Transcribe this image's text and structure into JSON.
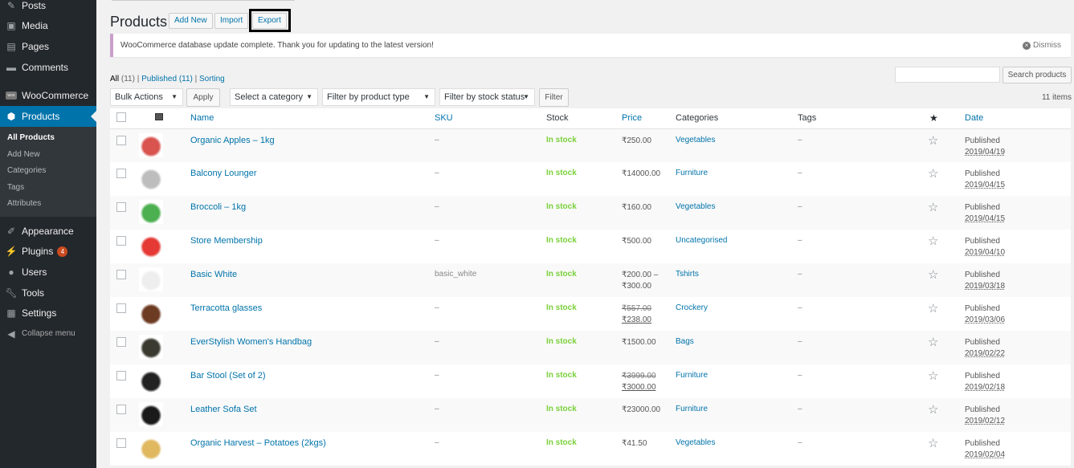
{
  "sidebar": {
    "items": [
      {
        "label": "Posts",
        "icon": "pin-icon"
      },
      {
        "label": "Media",
        "icon": "media-icon"
      },
      {
        "label": "Pages",
        "icon": "pages-icon"
      },
      {
        "label": "Comments",
        "icon": "comments-icon"
      }
    ],
    "woocommerce": {
      "label": "WooCommerce",
      "icon": "woo-icon"
    },
    "products": {
      "label": "Products",
      "icon": "box-icon"
    },
    "submenu": [
      "All Products",
      "Add New",
      "Categories",
      "Tags",
      "Attributes"
    ],
    "items2": [
      {
        "label": "Appearance",
        "icon": "brush-icon"
      },
      {
        "label": "Plugins",
        "icon": "plug-icon",
        "badge": "4"
      },
      {
        "label": "Users",
        "icon": "user-icon"
      },
      {
        "label": "Tools",
        "icon": "wrench-icon"
      },
      {
        "label": "Settings",
        "icon": "settings-icon"
      }
    ],
    "collapse_label": "Collapse menu"
  },
  "header": {
    "title": "Products",
    "add_new": "Add New",
    "import": "Import",
    "export": "Export"
  },
  "notice": {
    "text": "WooCommerce database update complete. Thank you for updating to the latest version!",
    "dismiss": "Dismiss"
  },
  "views": {
    "all": "All",
    "all_count": "(11)",
    "published": "Published",
    "published_count": "(11)",
    "sorting": "Sorting"
  },
  "search": {
    "placeholder": "",
    "button": "Search products"
  },
  "filters": {
    "bulk_actions": "Bulk Actions",
    "apply": "Apply",
    "category": "Select a category",
    "product_type": "Filter by product type",
    "stock_status": "Filter by stock status",
    "filter": "Filter",
    "items_count": "11 items"
  },
  "table": {
    "headers": {
      "name": "Name",
      "sku": "SKU",
      "stock": "Stock",
      "price": "Price",
      "categories": "Categories",
      "tags": "Tags",
      "date": "Date"
    },
    "rows": [
      {
        "name": "Organic Apples – 1kg",
        "sku": "–",
        "stock": "In stock",
        "price": "₹250.00",
        "price_old": "",
        "price_new": "",
        "category": "Vegetables",
        "tags": "–",
        "status": "Published",
        "date": "2019/04/19",
        "thumb": "#d9534f"
      },
      {
        "name": "Balcony Lounger",
        "sku": "–",
        "stock": "In stock",
        "price": "₹14000.00",
        "price_old": "",
        "price_new": "",
        "category": "Furniture",
        "tags": "–",
        "status": "Published",
        "date": "2019/04/15",
        "thumb": "#bdbdbd"
      },
      {
        "name": "Broccoli – 1kg",
        "sku": "–",
        "stock": "In stock",
        "price": "₹160.00",
        "price_old": "",
        "price_new": "",
        "category": "Vegetables",
        "tags": "–",
        "status": "Published",
        "date": "2019/04/15",
        "thumb": "#4caf50"
      },
      {
        "name": "Store Membership",
        "sku": "–",
        "stock": "In stock",
        "price": "₹500.00",
        "price_old": "",
        "price_new": "",
        "category": "Uncategorised",
        "tags": "–",
        "status": "Published",
        "date": "2019/04/10",
        "thumb": "#e53935"
      },
      {
        "name": "Basic White",
        "sku": "basic_white",
        "stock": "In stock",
        "price": "₹200.00 –",
        "price2": "₹300.00",
        "price_old": "",
        "price_new": "",
        "category": "Tshirts",
        "tags": "–",
        "status": "Published",
        "date": "2019/03/18",
        "thumb": "#eeeeee"
      },
      {
        "name": "Terracotta glasses",
        "sku": "–",
        "stock": "In stock",
        "price": "",
        "price_old": "₹557.00",
        "price_new": "₹238.00",
        "category": "Crockery",
        "tags": "–",
        "status": "Published",
        "date": "2019/03/06",
        "thumb": "#6d3a22"
      },
      {
        "name": "EverStylish Women's Handbag",
        "sku": "–",
        "stock": "In stock",
        "price": "₹1500.00",
        "price_old": "",
        "price_new": "",
        "category": "Bags",
        "tags": "–",
        "status": "Published",
        "date": "2019/02/22",
        "thumb": "#3a3a30"
      },
      {
        "name": "Bar Stool (Set of 2)",
        "sku": "–",
        "stock": "In stock",
        "price": "",
        "price_old": "₹3999.00",
        "price_new": "₹3000.00",
        "category": "Furniture",
        "tags": "–",
        "status": "Published",
        "date": "2019/02/18",
        "thumb": "#222222"
      },
      {
        "name": "Leather Sofa Set",
        "sku": "–",
        "stock": "In stock",
        "price": "₹23000.00",
        "price_old": "",
        "price_new": "",
        "category": "Furniture",
        "tags": "–",
        "status": "Published",
        "date": "2019/02/12",
        "thumb": "#1a1a1a"
      },
      {
        "name": "Organic Harvest – Potatoes (2kgs)",
        "sku": "–",
        "stock": "In stock",
        "price": "₹41.50",
        "price_old": "",
        "price_new": "",
        "category": "Vegetables",
        "tags": "–",
        "status": "Published",
        "date": "2019/02/04",
        "thumb": "#e0b860"
      }
    ]
  }
}
